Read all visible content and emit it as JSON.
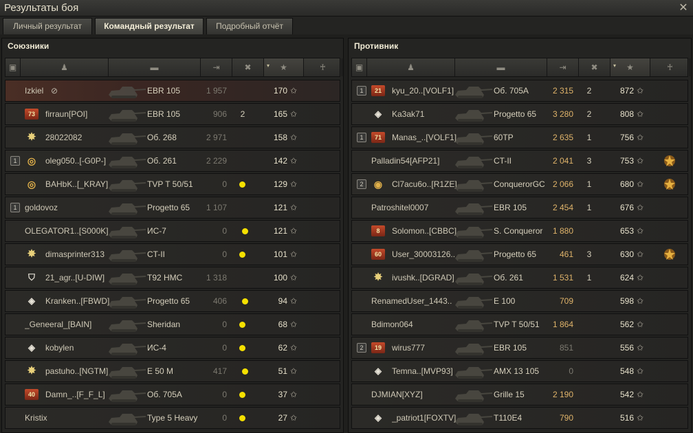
{
  "window": {
    "title": "Результаты боя"
  },
  "tabs": [
    "Личный результат",
    "Командный результат",
    "Подробный отчёт"
  ],
  "active_tab": 1,
  "allies": {
    "title": "Союзники",
    "rows": [
      {
        "name": "Izkiel",
        "squad": "",
        "rank": "",
        "vehicle": "EBR 105",
        "damage": "1 957",
        "damage_hi": false,
        "kills": "",
        "spot": false,
        "xp": "170",
        "medal": false,
        "me": true,
        "hidden": true
      },
      {
        "name": "firraun[POI]",
        "squad": "",
        "rank": "73",
        "rank_style": "stripe",
        "vehicle": "EBR 105",
        "damage": "906",
        "damage_hi": false,
        "kills": "2",
        "spot": false,
        "xp": "165",
        "medal": false
      },
      {
        "name": "28022082",
        "squad": "",
        "rank": "✸",
        "rank_style": "emblem",
        "vehicle": "Об. 268",
        "damage": "2 971",
        "damage_hi": false,
        "kills": "",
        "spot": false,
        "xp": "158",
        "medal": false
      },
      {
        "name": "oleg050..[-G0P-]",
        "squad": "1",
        "rank": "◎",
        "rank_style": "circle",
        "vehicle": "Об. 261",
        "damage": "2 229",
        "damage_hi": false,
        "kills": "",
        "spot": false,
        "xp": "142",
        "medal": false
      },
      {
        "name": "BAHbK..[_KRAY]",
        "squad": "",
        "rank": "◎",
        "rank_style": "circle",
        "vehicle": "TVP T 50/51",
        "damage": "0",
        "damage_hi": false,
        "kills": "",
        "spot": true,
        "xp": "129",
        "medal": false
      },
      {
        "name": "goldovoz",
        "squad": "1",
        "rank": "",
        "vehicle": "Progetto 65",
        "damage": "1 107",
        "damage_hi": false,
        "kills": "",
        "spot": false,
        "xp": "121",
        "medal": false
      },
      {
        "name": "OLEGATOR1..[S000K]",
        "squad": "",
        "rank": "",
        "vehicle": "ИС-7",
        "damage": "0",
        "damage_hi": false,
        "kills": "",
        "spot": true,
        "xp": "121",
        "medal": false
      },
      {
        "name": "dimasprinter313",
        "squad": "",
        "rank": "✸",
        "rank_style": "emblem",
        "vehicle": "CT-II",
        "damage": "0",
        "damage_hi": false,
        "kills": "",
        "spot": true,
        "xp": "101",
        "medal": false
      },
      {
        "name": "21_agr..[U-DIW]",
        "squad": "",
        "rank": "⛉",
        "rank_style": "diamond",
        "vehicle": "T92 HMC",
        "damage": "1 318",
        "damage_hi": false,
        "kills": "",
        "spot": false,
        "xp": "100",
        "medal": false
      },
      {
        "name": "Kranken..[FBWD]",
        "squad": "",
        "rank": "◈",
        "rank_style": "diamond",
        "vehicle": "Progetto 65",
        "damage": "406",
        "damage_hi": false,
        "kills": "",
        "spot": true,
        "xp": "94",
        "medal": false
      },
      {
        "name": "_Geneeral_[BAIN]",
        "squad": "",
        "rank": "",
        "vehicle": "Sheridan",
        "damage": "0",
        "damage_hi": false,
        "kills": "",
        "spot": true,
        "xp": "68",
        "medal": false
      },
      {
        "name": "kobylen",
        "squad": "",
        "rank": "◈",
        "rank_style": "diamond",
        "vehicle": "ИС-4",
        "damage": "0",
        "damage_hi": false,
        "kills": "",
        "spot": true,
        "xp": "62",
        "medal": false
      },
      {
        "name": "pastuho..[NGTM]",
        "squad": "",
        "rank": "✸",
        "rank_style": "emblem",
        "vehicle": "E 50 M",
        "damage": "417",
        "damage_hi": false,
        "kills": "",
        "spot": true,
        "xp": "51",
        "medal": false
      },
      {
        "name": "Damn_..[F_F_L]",
        "squad": "",
        "rank": "40",
        "rank_style": "stripe",
        "vehicle": "Об. 705А",
        "damage": "0",
        "damage_hi": false,
        "kills": "",
        "spot": true,
        "xp": "37",
        "medal": false
      },
      {
        "name": "Kristix",
        "squad": "",
        "rank": "",
        "vehicle": "Type 5 Heavy",
        "damage": "0",
        "damage_hi": false,
        "kills": "",
        "spot": true,
        "xp": "27",
        "medal": false
      }
    ]
  },
  "enemies": {
    "title": "Противник",
    "rows": [
      {
        "name": "kyu_20..[VOLF1]",
        "squad": "1",
        "rank": "21",
        "rank_style": "stripe",
        "vehicle": "Об. 705А",
        "damage": "2 315",
        "damage_hi": true,
        "kills": "2",
        "spot": false,
        "xp": "872",
        "medal": false
      },
      {
        "name": "Ka3ak71",
        "squad": "",
        "rank": "◈",
        "rank_style": "diamond",
        "vehicle": "Progetto 65",
        "damage": "3 280",
        "damage_hi": true,
        "kills": "2",
        "spot": false,
        "xp": "808",
        "medal": false
      },
      {
        "name": "Manas_..[VOLF1]",
        "squad": "1",
        "rank": "71",
        "rank_style": "stripe",
        "vehicle": "60TP",
        "damage": "2 635",
        "damage_hi": true,
        "kills": "1",
        "spot": false,
        "xp": "756",
        "medal": false
      },
      {
        "name": "Palladin54[AFP21]",
        "squad": "",
        "rank": "",
        "vehicle": "CT-II",
        "damage": "2 041",
        "damage_hi": true,
        "kills": "3",
        "spot": false,
        "xp": "753",
        "medal": true
      },
      {
        "name": "Cl7acu6o..[R1ZE]",
        "squad": "2",
        "rank": "◉",
        "rank_style": "circle",
        "vehicle": "ConquerorGC",
        "damage": "2 066",
        "damage_hi": true,
        "kills": "1",
        "spot": false,
        "xp": "680",
        "medal": true
      },
      {
        "name": "Patroshitel0007",
        "squad": "",
        "rank": "",
        "vehicle": "EBR 105",
        "damage": "2 454",
        "damage_hi": true,
        "kills": "1",
        "spot": false,
        "xp": "676",
        "medal": false
      },
      {
        "name": "Solomon..[CBBC]",
        "squad": "",
        "rank": "8",
        "rank_style": "stripe",
        "vehicle": "S. Conqueror",
        "damage": "1 880",
        "damage_hi": true,
        "kills": "",
        "spot": false,
        "xp": "653",
        "medal": false
      },
      {
        "name": "User_30003126..",
        "squad": "",
        "rank": "60",
        "rank_style": "stripe",
        "vehicle": "Progetto 65",
        "damage": "461",
        "damage_hi": true,
        "kills": "3",
        "spot": false,
        "xp": "630",
        "medal": true
      },
      {
        "name": "ivushk..[DGRAD]",
        "squad": "",
        "rank": "✸",
        "rank_style": "emblem",
        "vehicle": "Об. 261",
        "damage": "1 531",
        "damage_hi": true,
        "kills": "1",
        "spot": false,
        "xp": "624",
        "medal": false
      },
      {
        "name": "RenamedUser_1443..",
        "squad": "",
        "rank": "",
        "vehicle": "E 100",
        "damage": "709",
        "damage_hi": true,
        "kills": "",
        "spot": false,
        "xp": "598",
        "medal": false
      },
      {
        "name": "Bdimon064",
        "squad": "",
        "rank": "",
        "vehicle": "TVP T 50/51",
        "damage": "1 864",
        "damage_hi": true,
        "kills": "",
        "spot": false,
        "xp": "562",
        "medal": false
      },
      {
        "name": "wirus777",
        "squad": "2",
        "rank": "19",
        "rank_style": "stripe",
        "vehicle": "EBR 105",
        "damage": "851",
        "damage_hi": false,
        "kills": "",
        "spot": false,
        "xp": "556",
        "medal": false
      },
      {
        "name": "Temna..[MVP93]",
        "squad": "",
        "rank": "◈",
        "rank_style": "diamond",
        "vehicle": "AMX 13 105",
        "damage": "0",
        "damage_hi": false,
        "kills": "",
        "spot": false,
        "xp": "548",
        "medal": false
      },
      {
        "name": "DJMIAN[XYZ]",
        "squad": "",
        "rank": "",
        "vehicle": "Grille 15",
        "damage": "2 190",
        "damage_hi": true,
        "kills": "",
        "spot": false,
        "xp": "542",
        "medal": false
      },
      {
        "name": "_patriot1[FOXTV]",
        "squad": "",
        "rank": "◈",
        "rank_style": "diamond",
        "vehicle": "T110E4",
        "damage": "790",
        "damage_hi": true,
        "kills": "",
        "spot": false,
        "xp": "516",
        "medal": false
      }
    ]
  },
  "icons": {
    "close": "close-icon",
    "star": "star-icon",
    "medal": "medal-icon",
    "hidden": "eye-slash-icon"
  },
  "colors": {
    "spot_dot": "#f5e000",
    "damage_high": "#e0b46a",
    "me_row": "#4a2e25"
  }
}
